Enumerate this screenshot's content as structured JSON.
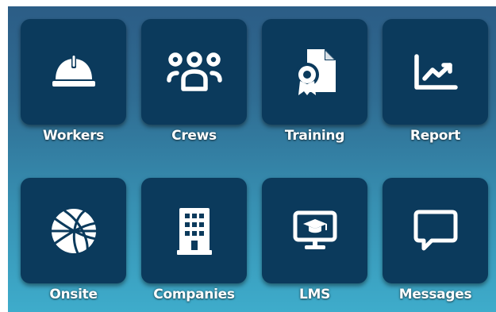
{
  "tiles": [
    {
      "label": "Workers",
      "icon": "hard-hat-icon"
    },
    {
      "label": "Crews",
      "icon": "users-group-icon"
    },
    {
      "label": "Training",
      "icon": "certificate-document-icon"
    },
    {
      "label": "Report",
      "icon": "trend-chart-icon"
    },
    {
      "label": "Onsite",
      "icon": "globe-icon"
    },
    {
      "label": "Companies",
      "icon": "building-icon"
    },
    {
      "label": "LMS",
      "icon": "monitor-graduation-cap-icon"
    },
    {
      "label": "Messages",
      "icon": "chat-bubble-icon"
    }
  ],
  "colors": {
    "tile": "#0b3a5c",
    "background_top": "#2c5d86",
    "background_bottom": "#3eaccb",
    "text": "#ffffff"
  }
}
